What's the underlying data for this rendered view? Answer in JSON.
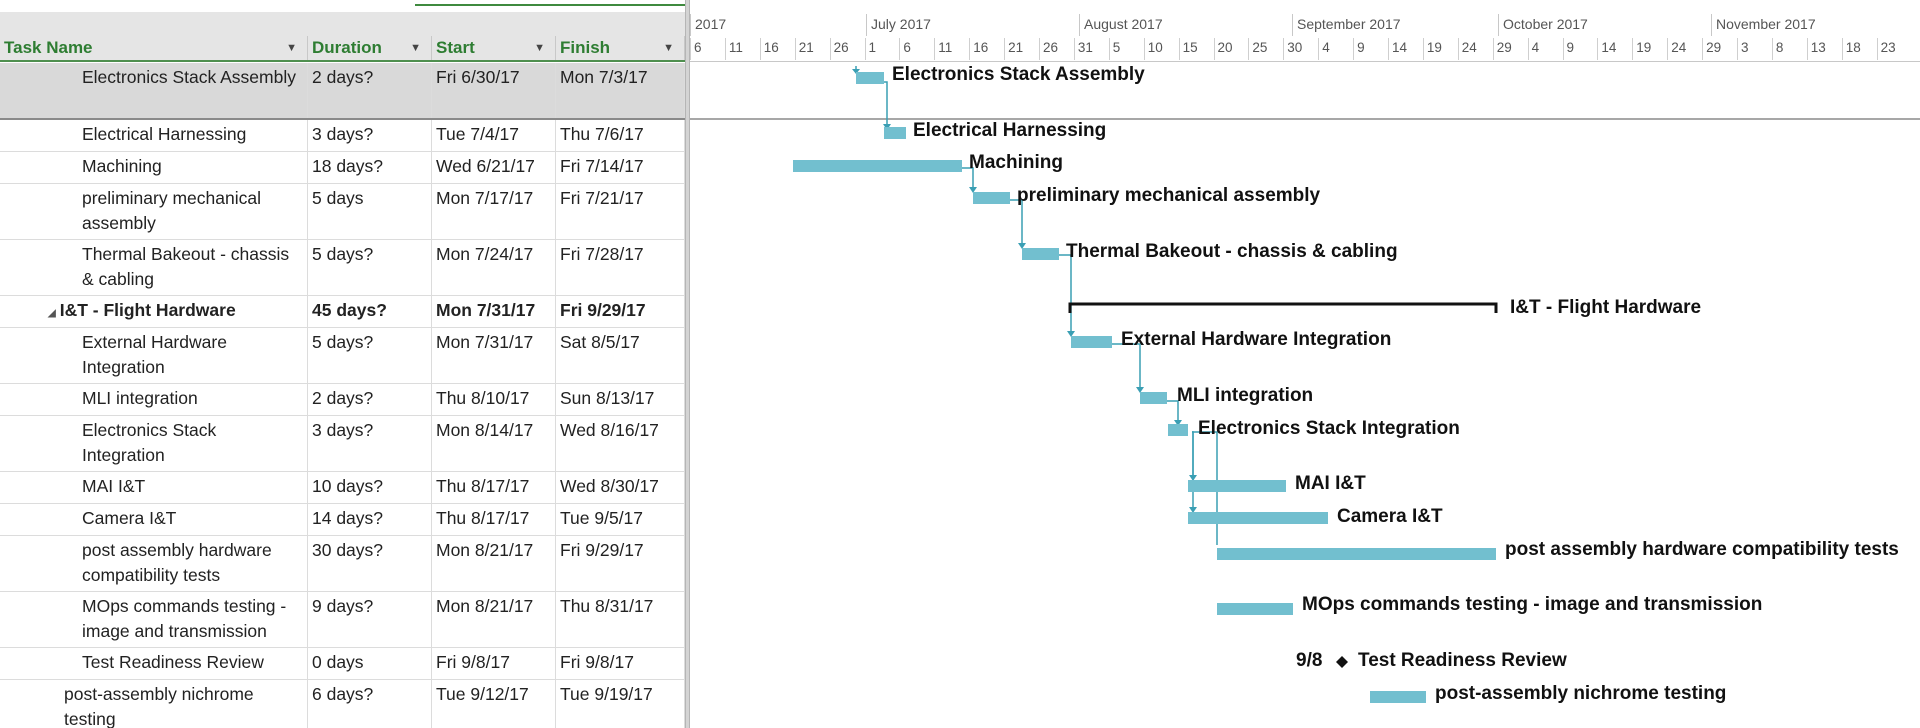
{
  "table": {
    "columns": {
      "name": "Task Name",
      "duration": "Duration",
      "start": "Start",
      "finish": "Finish"
    },
    "rows": [
      {
        "name": "Electronics Stack Assembly",
        "duration": "2 days?",
        "start": "Fri 6/30/17",
        "finish": "Mon 7/3/17",
        "selected": true
      },
      {
        "name": "Electrical Harnessing",
        "duration": "3 days?",
        "start": "Tue 7/4/17",
        "finish": "Thu 7/6/17"
      },
      {
        "name": "Machining",
        "duration": "18 days?",
        "start": "Wed 6/21/17",
        "finish": "Fri 7/14/17"
      },
      {
        "name": "preliminary mechanical assembly",
        "duration": "5 days",
        "start": "Mon 7/17/17",
        "finish": "Fri 7/21/17"
      },
      {
        "name": "Thermal Bakeout - chassis & cabling",
        "duration": "5 days?",
        "start": "Mon 7/24/17",
        "finish": "Fri 7/28/17"
      },
      {
        "name": "I&T - Flight Hardware",
        "duration": "45 days?",
        "start": "Mon 7/31/17",
        "finish": "Fri 9/29/17",
        "summary": true
      },
      {
        "name": "External Hardware Integration",
        "duration": "5 days?",
        "start": "Mon 7/31/17",
        "finish": "Sat 8/5/17"
      },
      {
        "name": "MLI integration",
        "duration": "2 days?",
        "start": "Thu 8/10/17",
        "finish": "Sun 8/13/17"
      },
      {
        "name": "Electronics Stack Integration",
        "duration": "3 days?",
        "start": "Mon 8/14/17",
        "finish": "Wed 8/16/17"
      },
      {
        "name": "MAI I&T",
        "duration": "10 days?",
        "start": "Thu 8/17/17",
        "finish": "Wed 8/30/17"
      },
      {
        "name": "Camera I&T",
        "duration": "14 days?",
        "start": "Thu 8/17/17",
        "finish": "Tue 9/5/17"
      },
      {
        "name": "post assembly hardware compatibility tests",
        "duration": "30 days?",
        "start": "Mon 8/21/17",
        "finish": "Fri 9/29/17"
      },
      {
        "name": "MOps commands testing - image and transmission",
        "duration": "9 days?",
        "start": "Mon 8/21/17",
        "finish": "Thu 8/31/17"
      },
      {
        "name": "Test Readiness Review",
        "duration": "0 days",
        "start": "Fri 9/8/17",
        "finish": "Fri 9/8/17"
      },
      {
        "name": "post-assembly nichrome testing",
        "duration": "6 days?",
        "start": "Tue 9/12/17",
        "finish": "Tue 9/19/17"
      }
    ]
  },
  "timescale": {
    "months": [
      "2017",
      "July 2017",
      "August 2017",
      "September 2017",
      "October 2017",
      "November 2017"
    ],
    "days": [
      "6",
      "11",
      "16",
      "21",
      "26",
      "1",
      "6",
      "11",
      "16",
      "21",
      "26",
      "31",
      "5",
      "10",
      "15",
      "20",
      "25",
      "30",
      "4",
      "9",
      "14",
      "19",
      "24",
      "29",
      "4",
      "9",
      "14",
      "19",
      "24",
      "29",
      "3",
      "8",
      "13",
      "18",
      "23"
    ]
  },
  "gantt": {
    "bar_color": "#72bfcf",
    "milestone_date_label": "9/8",
    "labels": [
      "Electronics Stack Assembly",
      "Electrical Harnessing",
      "Machining",
      "preliminary mechanical assembly",
      "Thermal Bakeout - chassis & cabling",
      "I&T - Flight Hardware",
      "External Hardware Integration",
      "MLI integration",
      "Electronics Stack Integration",
      "MAI I&T",
      "Camera I&T",
      "post assembly hardware compatibility tests",
      "MOps commands testing - image and transmission",
      "Test Readiness Review",
      "post-assembly nichrome testing"
    ]
  }
}
